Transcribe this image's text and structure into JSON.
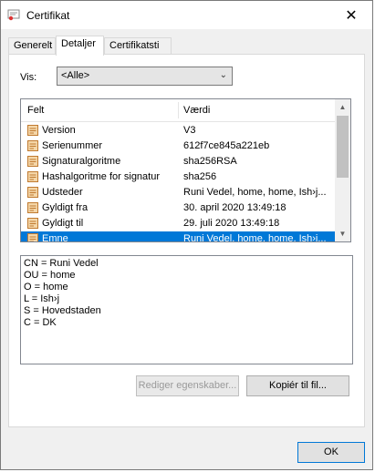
{
  "window": {
    "title": "Certifikat",
    "close_glyph": "✕"
  },
  "tabs": [
    {
      "label": "Generelt",
      "active": false
    },
    {
      "label": "Detaljer",
      "active": true
    },
    {
      "label": "Certifikatsti",
      "active": false
    }
  ],
  "filter": {
    "label": "Vis:",
    "selected": "<Alle>"
  },
  "list": {
    "columns": {
      "field": "Felt",
      "value": "Værdi"
    },
    "rows": [
      {
        "field": "Version",
        "value": "V3",
        "icon": "certificate-field-icon"
      },
      {
        "field": "Serienummer",
        "value": "612f7ce845a221eb",
        "icon": "certificate-field-icon"
      },
      {
        "field": "Signaturalgoritme",
        "value": "sha256RSA",
        "icon": "certificate-field-icon"
      },
      {
        "field": "Hashalgoritme for signatur",
        "value": "sha256",
        "icon": "certificate-field-icon"
      },
      {
        "field": "Udsteder",
        "value": "Runi Vedel, home, home, Ish›j...",
        "icon": "certificate-field-icon"
      },
      {
        "field": "Gyldigt fra",
        "value": "30. april 2020 13:49:18",
        "icon": "certificate-field-icon"
      },
      {
        "field": "Gyldigt til",
        "value": "29. juli 2020 13:49:18",
        "icon": "certificate-field-icon"
      },
      {
        "field": "Emne",
        "value": "Runi Vedel, home, home, Ish›j...",
        "icon": "certificate-field-icon",
        "selected": true
      }
    ]
  },
  "detail_lines": [
    "CN = Runi Vedel",
    "OU = home",
    "O = home",
    "L = Ish›j",
    "S = Hovedstaden",
    "C = DK"
  ],
  "buttons": {
    "edit_properties": "Rediger egenskaber...",
    "copy_to_file": "Kopiér til fil...",
    "ok": "OK"
  },
  "colors": {
    "selection": "#0078d7",
    "icon_fill": "#f4d6a8",
    "icon_stroke": "#c07a30"
  }
}
